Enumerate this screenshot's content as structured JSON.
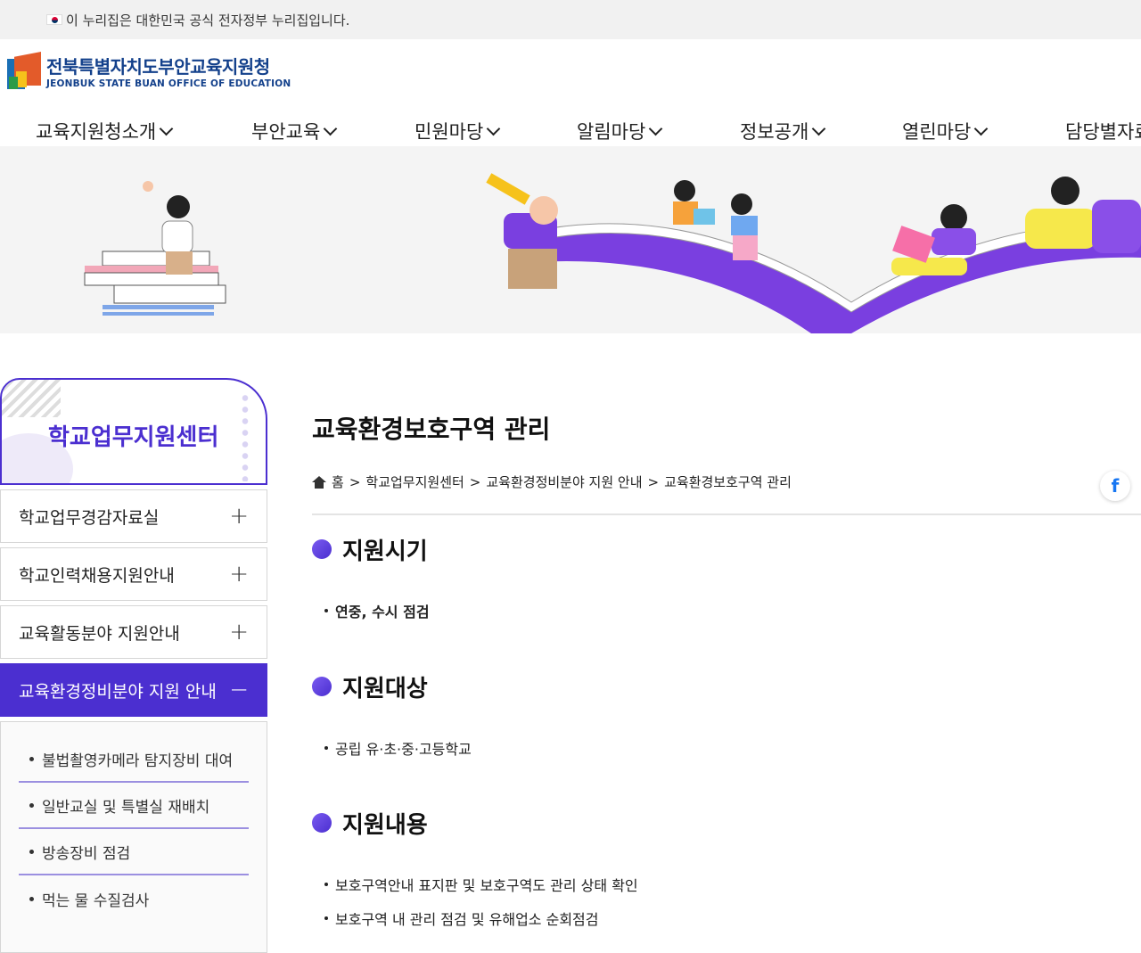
{
  "gov_bar": {
    "text": "이 누리집은 대한민국 공식 전자정부 누리집입니다."
  },
  "logo": {
    "name_ko": "전북특별자치도부안교육지원청",
    "name_en": "JEONBUK STATE BUAN OFFICE OF EDUCATION"
  },
  "nav": {
    "items": [
      {
        "label": "교육지원청소개"
      },
      {
        "label": "부안교육"
      },
      {
        "label": "민원마당"
      },
      {
        "label": "알림마당"
      },
      {
        "label": "정보공개"
      },
      {
        "label": "열린마당"
      },
      {
        "label": "담당별자료"
      }
    ]
  },
  "sidebar": {
    "title": "학교업무지원센터",
    "items": [
      {
        "label": "학교업무경감자료실",
        "toggle": "+"
      },
      {
        "label": "학교인력채용지원안내",
        "toggle": "+"
      },
      {
        "label": "교육활동분야 지원안내",
        "toggle": "+"
      },
      {
        "label": "교육환경정비분야 지원 안내",
        "toggle": "−"
      }
    ],
    "subitems": [
      {
        "label": "불법촬영카메라 탐지장비 대여"
      },
      {
        "label": "일반교실 및 특별실 재배치"
      },
      {
        "label": "방송장비 점검"
      },
      {
        "label": "먹는 물 수질검사"
      }
    ]
  },
  "content": {
    "title": "교육환경보호구역 관리",
    "breadcrumb": {
      "home": "홈",
      "sep": ">",
      "path": [
        "학교업무지원센터",
        "교육환경정비분야 지원 안내",
        "교육환경보호구역 관리"
      ]
    },
    "share": {
      "facebook": "f"
    },
    "sections": [
      {
        "heading": "지원시기",
        "items": [
          "연중, 수시 점검"
        ]
      },
      {
        "heading": "지원대상",
        "items": [
          "공립 유·초·중·고등학교"
        ]
      },
      {
        "heading": "지원내용",
        "items": [
          "보호구역안내 표지판 및 보호구역도 관리 상태 확인",
          "보호구역 내 관리 점검 및 유해업소 순회점검"
        ]
      }
    ]
  },
  "colors": {
    "accent": "#4b2fd0",
    "logo_blue": "#13408b"
  }
}
